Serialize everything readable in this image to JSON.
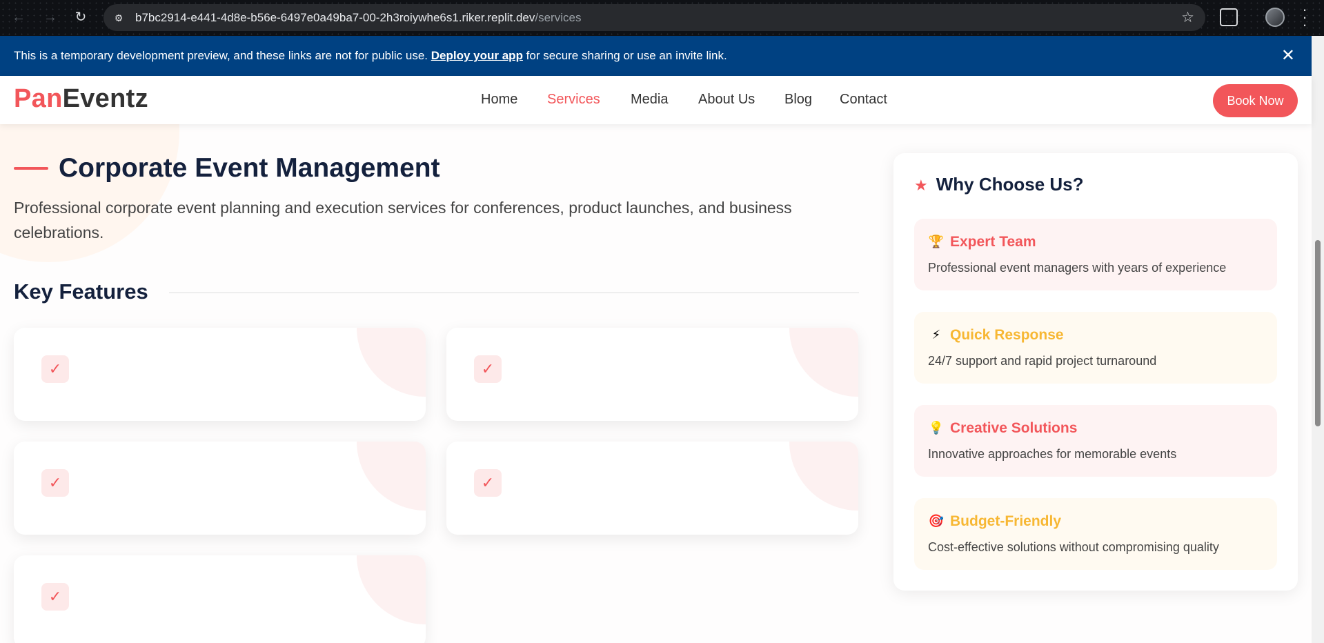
{
  "browser": {
    "url_host": "b7bc2914-e441-4d8e-b56e-6497e0a49ba7-00-2h3roiywhe6s1.riker.replit.dev",
    "url_path": "/services"
  },
  "banner": {
    "text_before": "This is a temporary development preview, and these links are not for public use. ",
    "link_text": "Deploy your app",
    "text_after": " for secure sharing or use an invite link.",
    "close_icon": "✕"
  },
  "header": {
    "logo_part1": "Pan",
    "logo_part2": "Eventz",
    "nav": [
      {
        "label": "Home",
        "active": false
      },
      {
        "label": "Services",
        "active": true
      },
      {
        "label": "Media",
        "active": false
      },
      {
        "label": "About Us",
        "active": false
      },
      {
        "label": "Blog",
        "active": false
      },
      {
        "label": "Contact",
        "active": false
      }
    ],
    "cta_label": "Book Now"
  },
  "main": {
    "title": "Corporate Event Management",
    "description": "Professional corporate event planning and execution services for conferences, product launches, and business celebrations.",
    "features_heading": "Key Features",
    "feature_cards": [
      {
        "check_icon": "✓"
      },
      {
        "check_icon": "✓"
      },
      {
        "check_icon": "✓"
      },
      {
        "check_icon": "✓"
      },
      {
        "check_icon": "✓"
      }
    ]
  },
  "sidebar": {
    "title": "Why Choose Us?",
    "title_icon": "★",
    "reasons": [
      {
        "icon": "🏆",
        "icon_name": "trophy-icon",
        "title": "Expert Team",
        "description": "Professional event managers with years of experience",
        "tone": "pink"
      },
      {
        "icon": "⚡",
        "icon_name": "lightning-icon",
        "title": "Quick Response",
        "description": "24/7 support and rapid project turnaround",
        "tone": "cream"
      },
      {
        "icon": "💡",
        "icon_name": "lightbulb-icon",
        "title": "Creative Solutions",
        "description": "Innovative approaches for memorable events",
        "tone": "pink"
      },
      {
        "icon": "🎯",
        "icon_name": "target-icon",
        "title": "Budget-Friendly",
        "description": "Cost-effective solutions without compromising quality",
        "tone": "cream"
      }
    ]
  },
  "colors": {
    "brand_accent": "#f2565a",
    "secondary_accent": "#f7b733",
    "heading": "#14213d",
    "banner_bg": "#004182"
  }
}
